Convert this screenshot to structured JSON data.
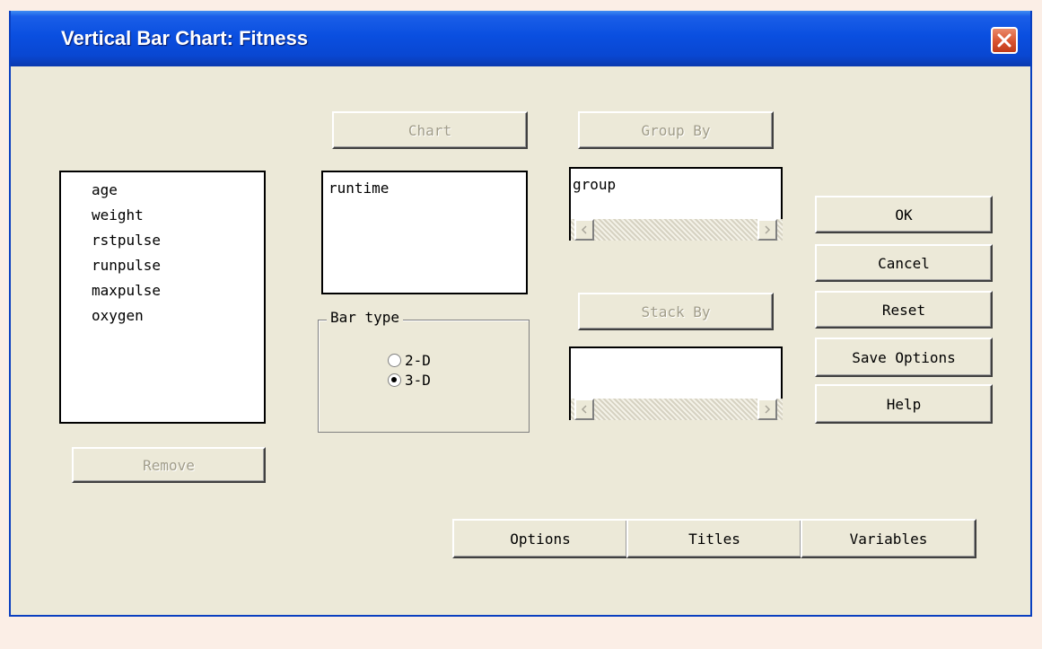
{
  "window": {
    "title": "Vertical Bar Chart: Fitness"
  },
  "variables_list": {
    "items": [
      "age",
      "weight",
      "rstpulse",
      "runpulse",
      "maxpulse",
      "oxygen"
    ]
  },
  "remove_button": {
    "label": "Remove"
  },
  "chart_button": {
    "label": "Chart"
  },
  "chart_list": {
    "items": [
      "runtime"
    ]
  },
  "bar_type": {
    "legend": "Bar type",
    "options": [
      {
        "label": "2-D",
        "selected": false
      },
      {
        "label": "3-D",
        "selected": true
      }
    ]
  },
  "group_by": {
    "button_label": "Group By",
    "value": "group"
  },
  "stack_by": {
    "button_label": "Stack By",
    "value": ""
  },
  "side_buttons": {
    "ok": "OK",
    "cancel": "Cancel",
    "reset": "Reset",
    "save_options": "Save Options",
    "help": "Help"
  },
  "bottom_tabs": {
    "options": "Options",
    "titles": "Titles",
    "variables": "Variables"
  },
  "colors": {
    "titlebar": "#0a4fe0",
    "dialog_bg": "#ece9d8",
    "close_button": "#d9532f"
  },
  "icons": {
    "close": "close-icon",
    "scroll_left": "arrow-left-icon",
    "scroll_right": "arrow-right-icon"
  }
}
